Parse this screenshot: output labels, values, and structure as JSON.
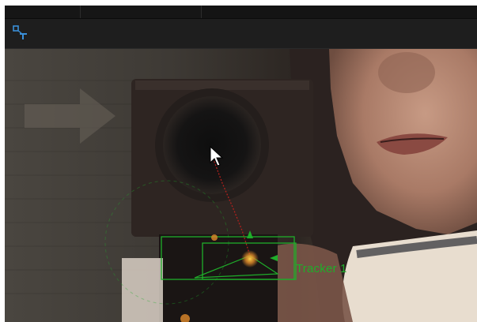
{
  "toolbar": {
    "tool_icon": "tracker-tool-icon"
  },
  "viewer": {
    "tracker_label": "Tracker 1"
  },
  "colors": {
    "tracker_green": "#1fae2a",
    "motion_path_red": "#b0201c",
    "ui_dark": "#1e1e1e",
    "tool_icon_blue": "#3a8fd8"
  }
}
